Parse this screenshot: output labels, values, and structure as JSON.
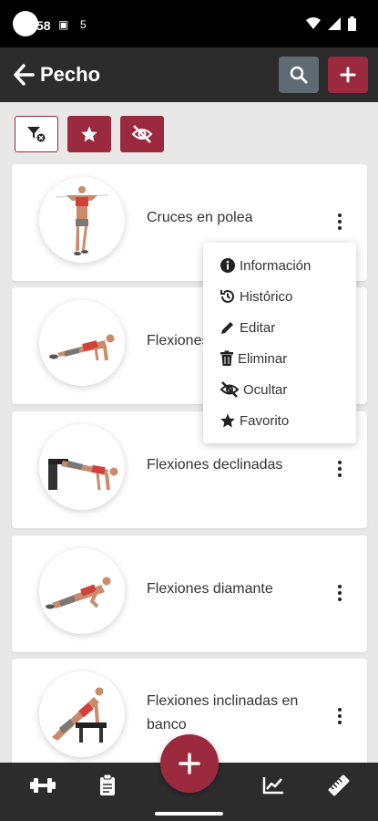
{
  "status_bar": {
    "time": "58",
    "sim_icon": "5"
  },
  "app_bar": {
    "title": "Pecho"
  },
  "exercises": [
    {
      "name": "Cruces en polea"
    },
    {
      "name": "Flexiones"
    },
    {
      "name": "Flexiones declinadas"
    },
    {
      "name": "Flexiones diamante"
    },
    {
      "name": "Flexiones inclinadas en banco"
    }
  ],
  "context_menu": {
    "items": [
      {
        "label": "Información",
        "icon": "info-icon"
      },
      {
        "label": "Histórico",
        "icon": "history-icon"
      },
      {
        "label": "Editar",
        "icon": "pencil-icon"
      },
      {
        "label": "Eliminar",
        "icon": "trash-icon"
      },
      {
        "label": "Ocultar",
        "icon": "eye-slash-icon"
      },
      {
        "label": "Favorito",
        "icon": "star-icon"
      }
    ]
  },
  "colors": {
    "accent": "#9c2a3f",
    "appbar": "#2c2c2c",
    "search": "#5f6b73"
  },
  "bottom_nav": {
    "icons": [
      "dumbbell-icon",
      "clipboard-icon",
      "plus-icon",
      "chart-icon",
      "ruler-icon"
    ]
  }
}
